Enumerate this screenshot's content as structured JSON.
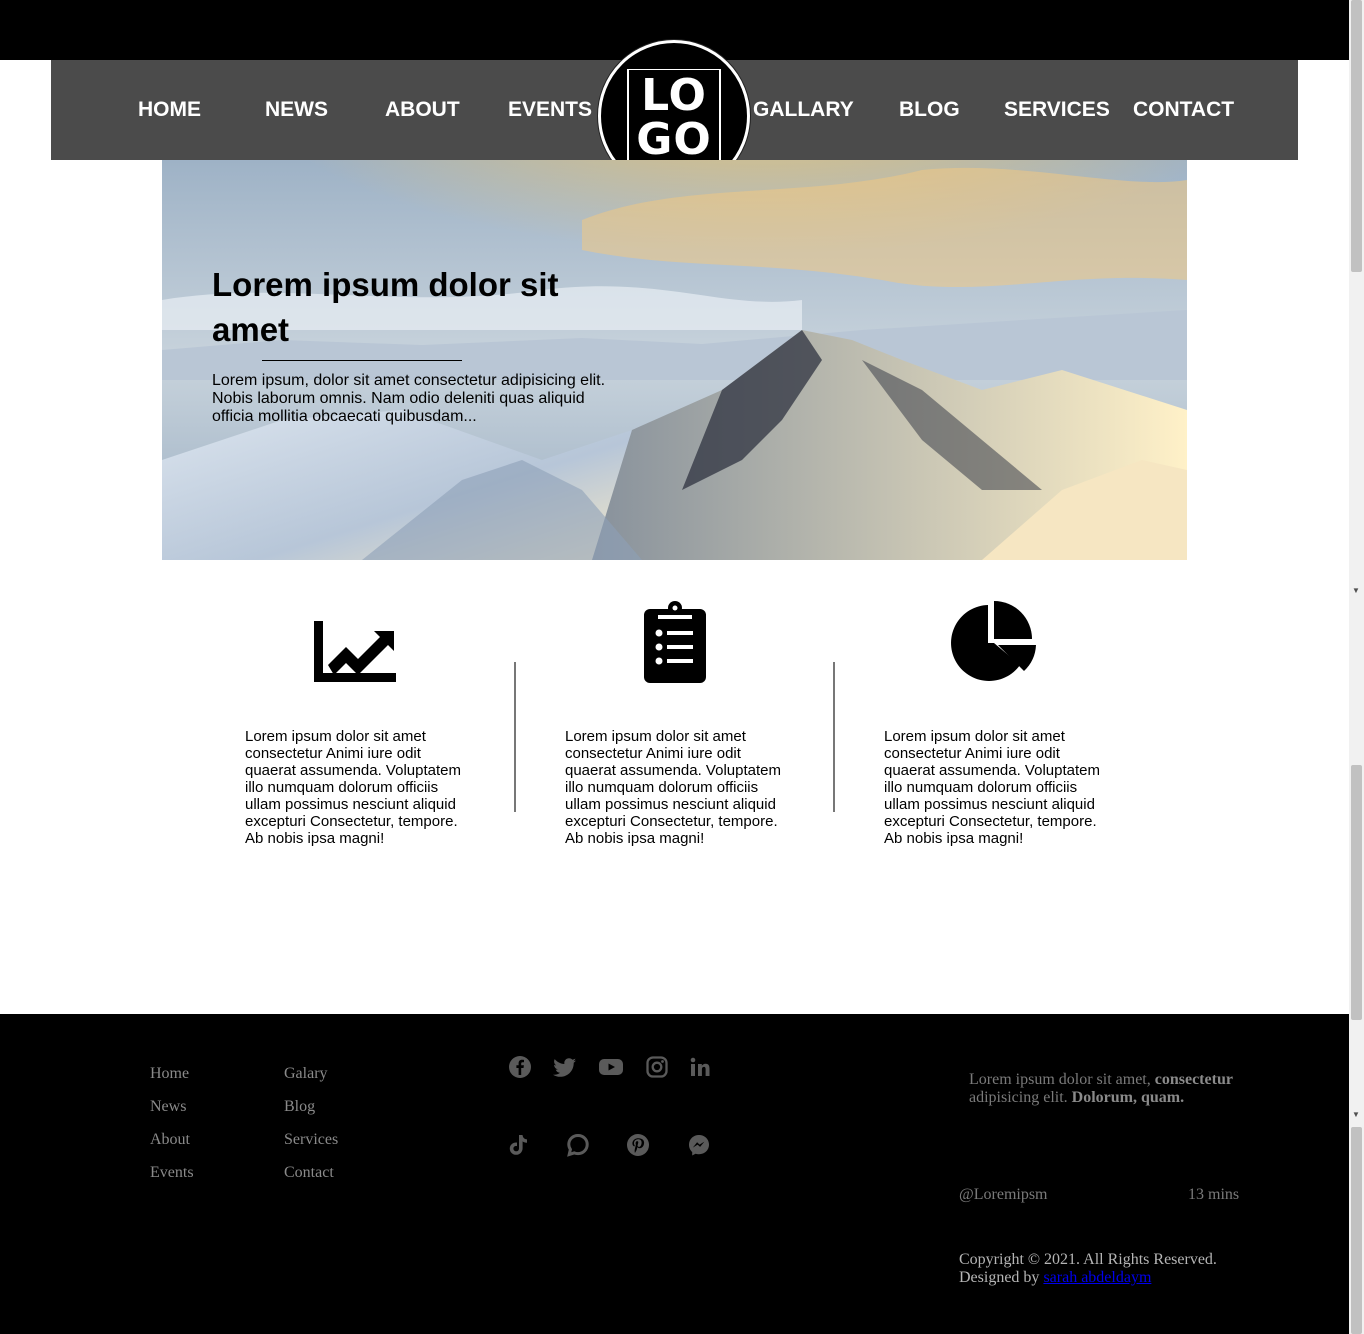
{
  "nav": {
    "items": [
      {
        "label": "HOME"
      },
      {
        "label": "NEWS"
      },
      {
        "label": "ABOUT"
      },
      {
        "label": "EVENTS"
      },
      {
        "label": "GALLARY"
      },
      {
        "label": "BLOG"
      },
      {
        "label": "SERVICES"
      },
      {
        "label": "CONTACT"
      }
    ],
    "logo_line1": "LO",
    "logo_line2": "GO"
  },
  "hero": {
    "title": "Lorem ipsum dolor sit amet",
    "text": "Lorem ipsum, dolor sit amet consectetur adipisicing elit. Nobis laborum omnis. Nam odio deleniti quas aliquid officia mollitia obcaecati quibusdam..."
  },
  "features": [
    {
      "icon": "chart-line-icon",
      "text": "Lorem ipsum dolor sit amet consectetur Animi iure odit quaerat assumenda. Voluptatem illo numquam dolorum officiis ullam possimus nesciunt aliquid excepturi Consectetur, tempore. Ab nobis ipsa magni!"
    },
    {
      "icon": "clipboard-list-icon",
      "text": "Lorem ipsum dolor sit amet consectetur Animi iure odit quaerat assumenda. Voluptatem illo numquam dolorum officiis ullam possimus nesciunt aliquid excepturi Consectetur, tempore. Ab nobis ipsa magni!"
    },
    {
      "icon": "chart-pie-icon",
      "text": "Lorem ipsum dolor sit amet consectetur Animi iure odit quaerat assumenda. Voluptatem illo numquam dolorum officiis ullam possimus nesciunt aliquid excepturi Consectetur, tempore. Ab nobis ipsa magni!"
    }
  ],
  "footer": {
    "links_col1": [
      "Home",
      "News",
      "About",
      "Events"
    ],
    "links_col2": [
      "Galary",
      "Blog",
      "Services",
      "Contact"
    ],
    "social_row1": [
      "facebook-icon",
      "twitter-icon",
      "youtube-icon",
      "instagram-icon",
      "linkedin-icon"
    ],
    "social_row2": [
      "tiktok-icon",
      "chat-icon",
      "pinterest-icon",
      "messenger-icon"
    ],
    "about_plain1": "Lorem ipsum dolor sit amet, ",
    "about_bold1": "consectetur",
    "about_plain2": " adipisicing elit. ",
    "about_bold2": "Dolorum, quam.",
    "handle": "@Loremipsm",
    "time": "13 mins",
    "copyright": "Copyright © 2021. All Rights Reserved.",
    "designed_by": "Designed by ",
    "designer": "sarah abdeldaym"
  },
  "colors": {
    "nav_bg": "#4b4b4b",
    "footer_bg": "#000000",
    "footer_link": "#8a8a8a",
    "designer_link": "#0000ee"
  }
}
